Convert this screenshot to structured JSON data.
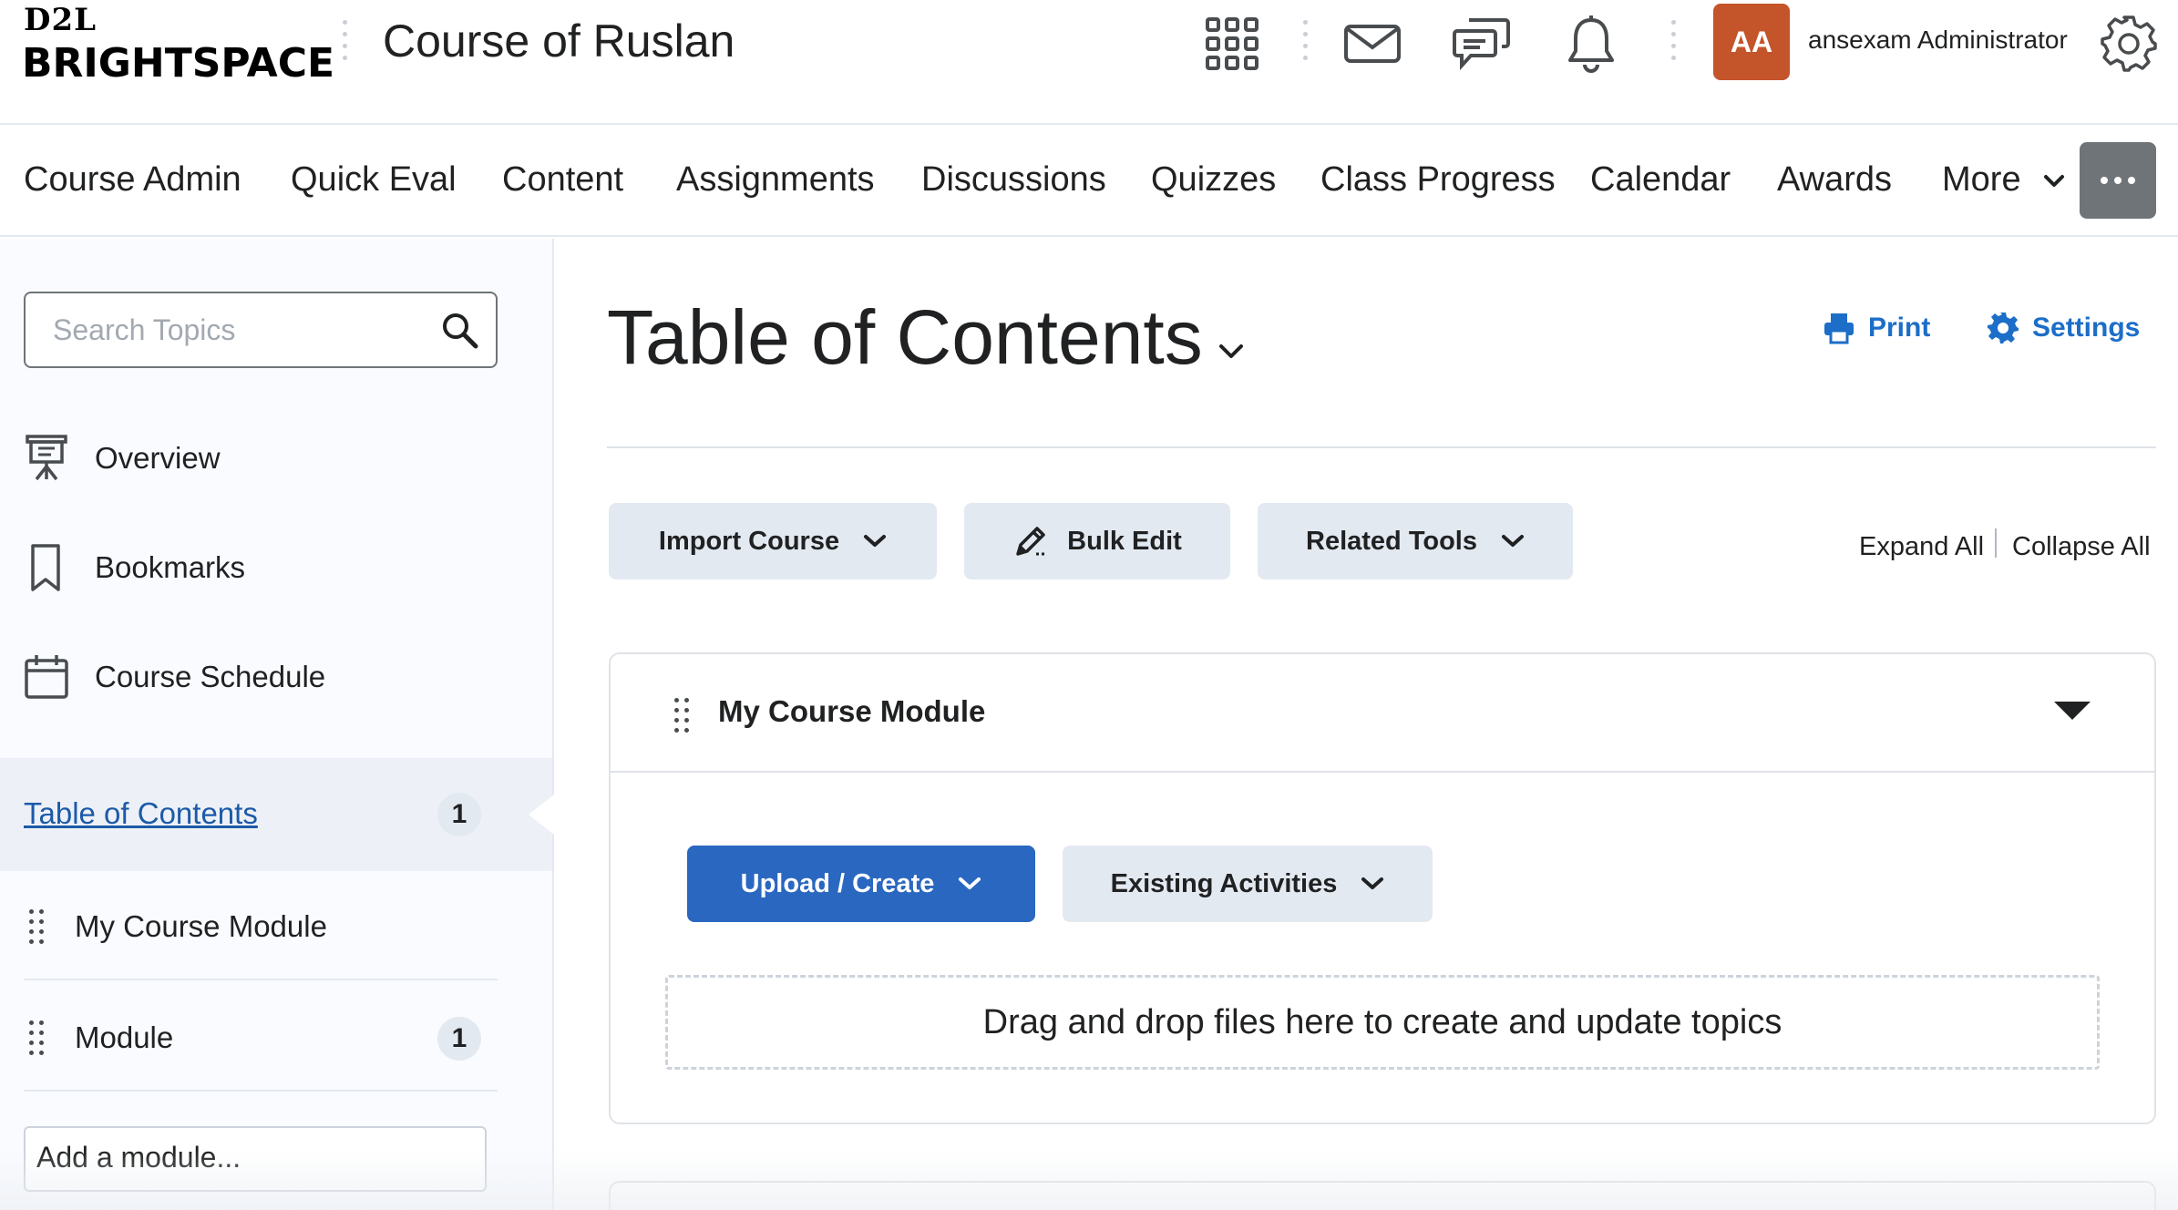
{
  "brand": {
    "logo_top": "D2L",
    "logo_bottom": "BRIGHTSPACE"
  },
  "header": {
    "course_title": "Course of Ruslan",
    "icons": [
      "waffle-icon",
      "mail-icon",
      "chat-icon",
      "bell-icon",
      "gear-icon"
    ],
    "avatar_initials": "AA",
    "avatar_color": "#c4552b",
    "username": "ansexam Administrator"
  },
  "nav": {
    "items": [
      "Course Admin",
      "Quick Eval",
      "Content",
      "Assignments",
      "Discussions",
      "Quizzes",
      "Class Progress",
      "Calendar",
      "Awards"
    ],
    "more_label": "More"
  },
  "sidebar": {
    "search_placeholder": "Search Topics",
    "links": [
      {
        "label": "Overview",
        "icon": "presentation-icon"
      },
      {
        "label": "Bookmarks",
        "icon": "bookmark-icon"
      },
      {
        "label": "Course Schedule",
        "icon": "calendar-icon"
      }
    ],
    "toc": {
      "label": "Table of Contents",
      "count": "1"
    },
    "modules": [
      {
        "label": "My Course Module",
        "count": ""
      },
      {
        "label": "Module",
        "count": "1"
      }
    ],
    "add_module_placeholder": "Add a module..."
  },
  "main": {
    "title": "Table of Contents",
    "print_label": "Print",
    "settings_label": "Settings",
    "buttons": {
      "import_course": "Import Course",
      "bulk_edit": "Bulk Edit",
      "related_tools": "Related Tools"
    },
    "expand_all": "Expand All",
    "collapse_all": "Collapse All",
    "module": {
      "title": "My Course Module",
      "upload_create": "Upload / Create",
      "existing_activities": "Existing Activities",
      "dropzone_text": "Drag and drop files here to create and update topics"
    }
  },
  "colors": {
    "accent": "#2a67c0",
    "link": "#1c6ec8",
    "button_bg": "#e3e9f1"
  }
}
